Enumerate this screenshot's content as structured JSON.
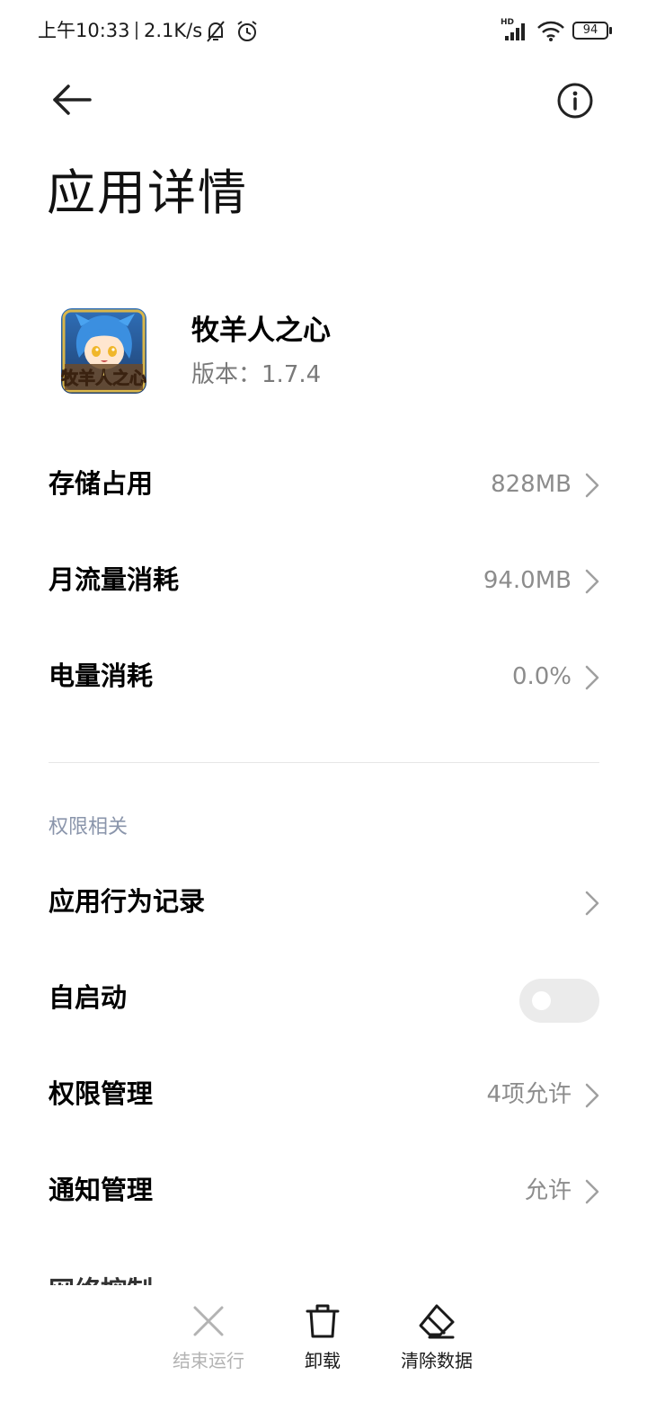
{
  "status_bar": {
    "time": "上午10:33",
    "speed": "2.1K/s",
    "battery": "94",
    "network_label": "HD"
  },
  "header": {
    "title": "应用详情"
  },
  "app": {
    "name": "牧羊人之心",
    "version_label": "版本：",
    "version": "1.7.4",
    "icon_text": "牧羊人之心"
  },
  "usage": [
    {
      "label": "存储占用",
      "value": "828MB"
    },
    {
      "label": "月流量消耗",
      "value": "94.0MB"
    },
    {
      "label": "电量消耗",
      "value": "0.0%"
    }
  ],
  "permissions_section": {
    "header": "权限相关",
    "behavior_record": "应用行为记录",
    "autostart": {
      "label": "自启动",
      "enabled": false
    },
    "permission_manage": {
      "label": "权限管理",
      "value": "4项允许"
    },
    "notification_manage": {
      "label": "通知管理",
      "value": "允许"
    },
    "next_item_partial": "网络控制"
  },
  "actions": {
    "stop": "结束运行",
    "uninstall": "卸载",
    "clear_data": "清除数据"
  },
  "colors": {
    "secondary_text": "#8c8c8c",
    "section_header": "#8a95ab",
    "disabled_action": "#b3b3b3",
    "toggle_off": "#ebebeb"
  }
}
